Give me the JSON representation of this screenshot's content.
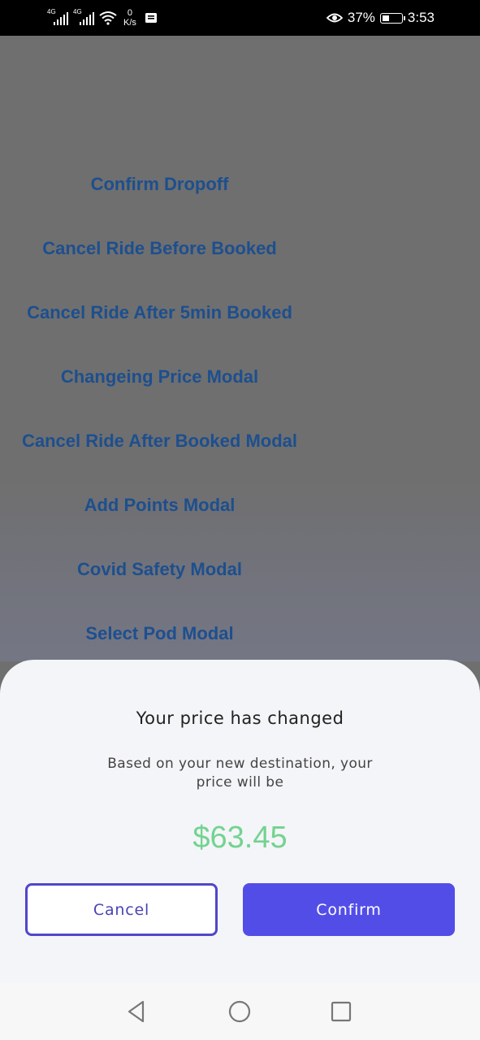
{
  "status_bar": {
    "signal1_label": "4G",
    "signal2_label": "4G",
    "speed_value": "0",
    "speed_unit": "K/s",
    "battery_percent": "37%",
    "battery_level": 0.37,
    "time": "3:53",
    "icons": [
      "signal-icon",
      "signal-icon",
      "wifi-icon",
      "message-icon",
      "eye-icon",
      "battery-icon"
    ]
  },
  "menu": {
    "items": [
      "Confirm Dropoff",
      "Cancel Ride Before Booked",
      "Cancel Ride After 5min Booked",
      "Changeing Price Modal",
      "Cancel Ride After Booked Modal",
      "Add Points Modal",
      "Covid Safety Modal",
      "Select Pod Modal"
    ]
  },
  "modal": {
    "title": "Your price has changed",
    "subtitle": "Based on your new destination, your price will be",
    "price": "$63.45",
    "cancel_label": "Cancel",
    "confirm_label": "Confirm"
  },
  "colors": {
    "menu_text": "#1d4f8e",
    "price": "#73d390",
    "accent": "#534de8"
  },
  "nav_bar": {
    "icons": [
      "back-icon",
      "home-icon",
      "recents-icon"
    ]
  }
}
